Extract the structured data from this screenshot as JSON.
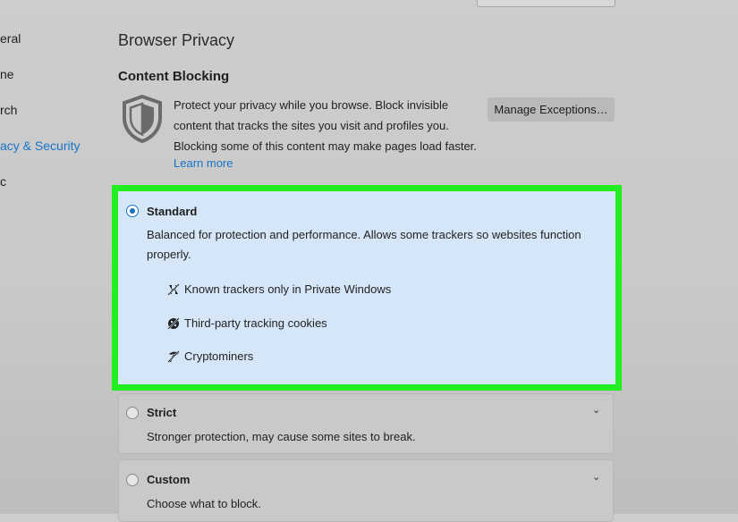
{
  "sidebar": {
    "items": [
      {
        "label": "eral",
        "active": false
      },
      {
        "label": "ne",
        "active": false
      },
      {
        "label": "rch",
        "active": false
      },
      {
        "label": "acy & Security",
        "active": true
      },
      {
        "label": "c",
        "active": false
      }
    ]
  },
  "page_title": "Browser Privacy",
  "content_blocking": {
    "heading": "Content Blocking",
    "icon": "shield-icon",
    "description_lines": [
      "Protect your privacy while you browse. Block invisible",
      "content that tracks the sites you visit and profiles you.",
      "Blocking some of this content may make pages load faster."
    ],
    "learn_more": "Learn more",
    "manage_exceptions": "Manage Exceptions…"
  },
  "options": {
    "standard": {
      "title": "Standard",
      "selected": true,
      "description_lines": [
        "Balanced for protection and performance. Allows some trackers so websites function",
        "properly."
      ],
      "trackers": [
        {
          "icon": "tracker-icon",
          "label": "Known trackers only in Private Windows"
        },
        {
          "icon": "cookie-blocked-icon",
          "label": "Third-party tracking cookies"
        },
        {
          "icon": "cryptominer-icon",
          "label": "Cryptominers"
        }
      ]
    },
    "strict": {
      "title": "Strict",
      "selected": false,
      "description": "Stronger protection, may cause some sites to break."
    },
    "custom": {
      "title": "Custom",
      "selected": false,
      "description": "Choose what to block."
    }
  },
  "colors": {
    "accent": "#1873c7",
    "highlight_border": "#22ee22",
    "selected_background": "#d4e6f8"
  }
}
